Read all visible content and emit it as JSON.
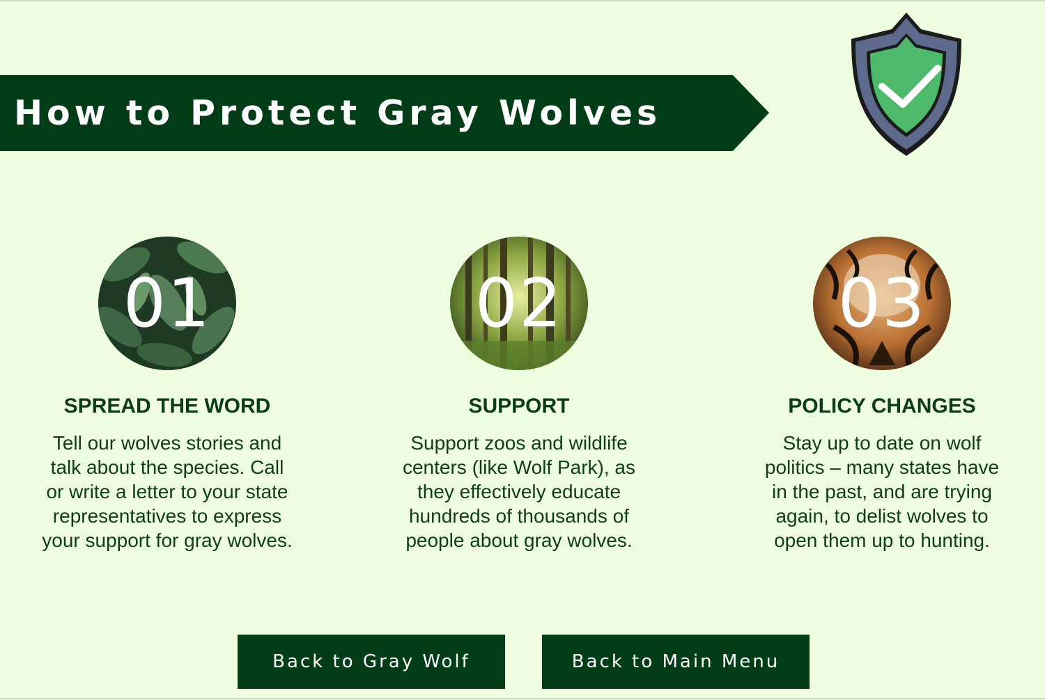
{
  "page": {
    "title": "How to Protect Gray Wolves",
    "accent_color": "#033d18",
    "background_color": "#eefde0"
  },
  "shield": {
    "icon": "shield-check-icon",
    "colors": {
      "outer": "#5d6a8c",
      "inner": "#4cba6a",
      "check": "#ffffff"
    }
  },
  "steps": [
    {
      "number": "01",
      "image": "green-leaves-photo",
      "heading": "SPREAD THE WORD",
      "description": "Tell our wolves stories and talk about the species. Call or write a letter to your state representatives to express your support for gray wolves."
    },
    {
      "number": "02",
      "image": "forest-photo",
      "heading": "SUPPORT",
      "description": "Support zoos and wildlife centers (like Wolf Park), as they effectively educate hundreds of thousands of people about gray wolves."
    },
    {
      "number": "03",
      "image": "tiger-photo",
      "heading": "POLICY CHANGES",
      "description": "Stay up to date on wolf politics – many states have in the past, and are trying again, to delist wolves to open them up to hunting."
    }
  ],
  "buttons": {
    "back_to_gray_wolf": "Back to Gray Wolf",
    "back_to_main_menu": "Back to Main Menu"
  }
}
